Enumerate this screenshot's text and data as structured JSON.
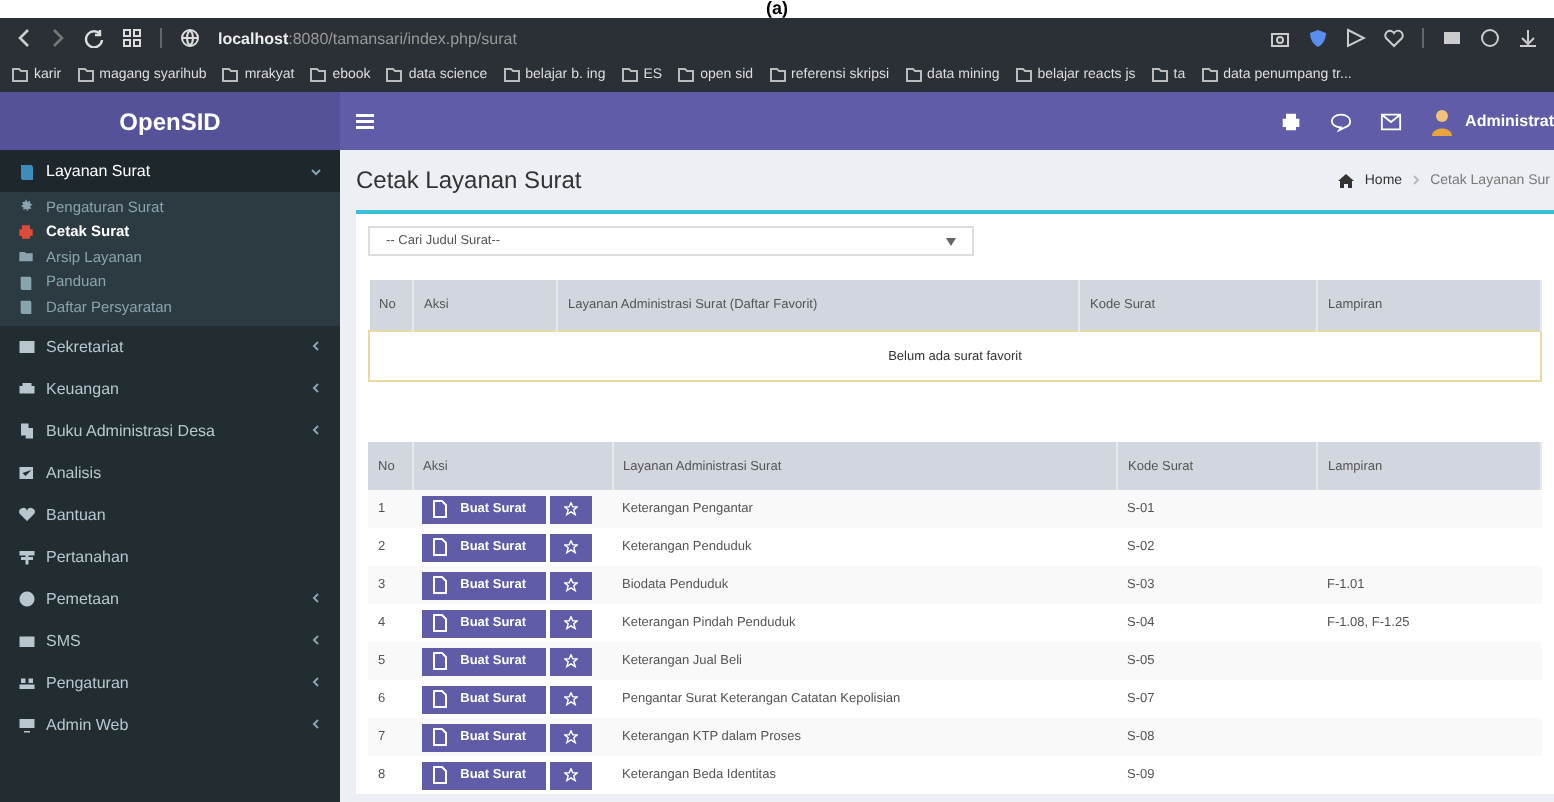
{
  "caption": "(a)",
  "browser": {
    "url_host": "localhost",
    "url_rest": ":8080/tamansari/index.php/surat",
    "bookmarks": [
      "karir",
      "magang syarihub",
      "mrakyat",
      "ebook",
      "data science",
      "belajar b. ing",
      "ES",
      "open sid",
      "referensi skripsi",
      "data mining",
      "belajar reacts js",
      "ta",
      "data penumpang tr..."
    ]
  },
  "app": {
    "brand": "OpenSID",
    "user": "Administrat"
  },
  "sidebar": {
    "items": [
      {
        "label": "Layanan Surat",
        "submenu": true,
        "expanded": true,
        "children": [
          {
            "label": "Pengaturan Surat",
            "selected": false
          },
          {
            "label": "Cetak Surat",
            "selected": true
          },
          {
            "label": "Arsip Layanan",
            "selected": false
          },
          {
            "label": "Panduan",
            "selected": false
          },
          {
            "label": "Daftar Persyaratan",
            "selected": false
          }
        ]
      },
      {
        "label": "Sekretariat",
        "submenu": true,
        "expanded": false
      },
      {
        "label": "Keuangan",
        "submenu": true,
        "expanded": false
      },
      {
        "label": "Buku Administrasi Desa",
        "submenu": true,
        "expanded": false
      },
      {
        "label": "Analisis",
        "submenu": false,
        "expanded": false
      },
      {
        "label": "Bantuan",
        "submenu": false,
        "expanded": false
      },
      {
        "label": "Pertanahan",
        "submenu": false,
        "expanded": false
      },
      {
        "label": "Pemetaan",
        "submenu": true,
        "expanded": false
      },
      {
        "label": "SMS",
        "submenu": true,
        "expanded": false
      },
      {
        "label": "Pengaturan",
        "submenu": true,
        "expanded": false
      },
      {
        "label": "Admin Web",
        "submenu": true,
        "expanded": false
      }
    ]
  },
  "page": {
    "title": "Cetak Layanan Surat",
    "breadcrumb": [
      "Home",
      "Cetak Layanan Sur"
    ],
    "search": {
      "placeholder": "-- Cari Judul Surat--"
    },
    "favorites": {
      "columns": [
        "No",
        "Aksi",
        "Layanan Administrasi Surat (Daftar Favorit)",
        "Kode Surat",
        "Lampiran"
      ],
      "empty": "Belum ada surat favorit"
    },
    "table": {
      "columns": [
        "No",
        "Aksi",
        "Layanan Administrasi Surat",
        "Kode Surat",
        "Lampiran"
      ],
      "rows": [
        {
          "no": "1",
          "button": "Buat Surat",
          "name": "Keterangan Pengantar",
          "code": "S-01"
        },
        {
          "no": "2",
          "button": "Buat Surat",
          "name": "Keterangan Penduduk",
          "code": "S-02"
        },
        {
          "no": "3",
          "button": "Buat Surat",
          "name": "Biodata Penduduk",
          "code": "S-03",
          "attachment": "F-1.01"
        },
        {
          "no": "4",
          "button": "Buat Surat",
          "name": "Keterangan Pindah Penduduk",
          "code": "S-04",
          "attachment": "F-1.08, F-1.25"
        },
        {
          "no": "5",
          "button": "Buat Surat",
          "name": "Keterangan Jual Beli",
          "code": "S-05"
        },
        {
          "no": "6",
          "button": "Buat Surat",
          "name": "Pengantar Surat Keterangan Catatan Kepolisian",
          "code": "S-07"
        },
        {
          "no": "7",
          "button": "Buat Surat",
          "name": "Keterangan KTP dalam Proses",
          "code": "S-08"
        },
        {
          "no": "8",
          "button": "Buat Surat",
          "name": "Keterangan Beda Identitas",
          "code": "S-09"
        }
      ]
    }
  }
}
